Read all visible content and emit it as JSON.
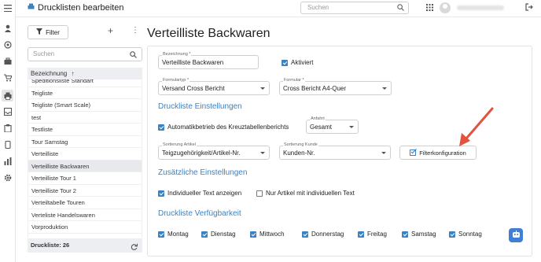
{
  "app": {
    "title": "Drucklisten bearbeiten"
  },
  "top": {
    "search_placeholder": "Suchen"
  },
  "rail": {
    "icons": [
      "menu-icon",
      "user-icon",
      "target-icon",
      "briefcase-icon",
      "cart-icon",
      "printer-icon",
      "inbox-icon",
      "clipboard-icon",
      "tablet-icon",
      "chart-icon",
      "settings-icon"
    ]
  },
  "left": {
    "filter_label": "Filter",
    "search_placeholder": "Suchen",
    "column_header": "Bezeichnung",
    "items": [
      "Speditionsliste Standart",
      "Teigliste",
      "Teigliste (Smart Scale)",
      "test",
      "Testliste",
      "Tour Samstag",
      "Verteilliste",
      "Verteilliste Backwaren",
      "Verteilliste Tour 1",
      "Verteilliste Tour 2",
      "Verteiltabelle Touren",
      "Verteliste Handelswaren",
      "Vorproduktion"
    ],
    "selected_index": 7,
    "footer": "Druckliste: 26"
  },
  "main": {
    "title": "Verteilliste Backwaren",
    "bezeichnung_label": "Bezeichnung *",
    "bezeichnung_value": "Verteilliste Backwaren",
    "aktiviert_label": "Aktiviert",
    "aktiviert_checked": true,
    "formulartyp_label": "Formulartyp *",
    "formulartyp_value": "Versand Cross Bericht",
    "formular_label": "Formular *",
    "formular_value": "Cross Bericht A4-Quer",
    "section1": "Druckliste Einstellungen",
    "auto_label": "Automatikbetrieb des Kreuztabellenberichts",
    "auto_checked": true,
    "anfahrt_label": "Anfahrt",
    "anfahrt_value": "Gesamt",
    "sort_artikel_label": "Sortierung Artikel",
    "sort_artikel_value": "Teigzugehörigkeit/Artikel-Nr.",
    "sort_kunde_label": "Sortierung Kunde",
    "sort_kunde_value": "Kunden-Nr.",
    "filter_button": "Filterkonfiguration",
    "section2": "Zusätzliche Einstellungen",
    "individueller_label": "Individueller Text anzeigen",
    "individueller_checked": true,
    "nur_artikel_label": "Nur Artikel mit individuellen Text",
    "nur_artikel_checked": false,
    "section3": "Druckliste Verfügbarkeit",
    "days": [
      "Montag",
      "Dienstag",
      "Mittwoch",
      "Donnerstag",
      "Freitag",
      "Samstag",
      "Sonntag"
    ],
    "accent": "#3b82c4",
    "arrow_color": "#e0533f"
  }
}
